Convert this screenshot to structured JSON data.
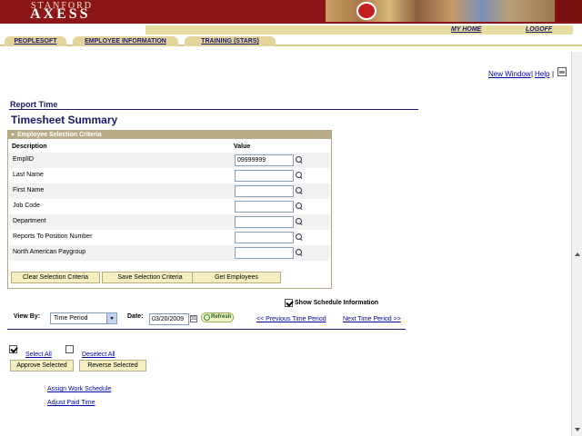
{
  "header": {
    "logo_top": "STANFORD",
    "logo_main": "AXESS",
    "my_home": "MY HOME",
    "logoff": "LOGOFF"
  },
  "tabs": [
    {
      "label": "PEOPLESOFT"
    },
    {
      "label": "EMPLOYEE INFORMATION"
    },
    {
      "label": "TRAINING (STARS)"
    }
  ],
  "toplinks": {
    "new_window": "New Window",
    "sep": "|",
    "help": "Help",
    "sep2": "|"
  },
  "page": {
    "report_time": "Report Time",
    "title": "Timesheet Summary"
  },
  "criteria": {
    "header": "Employee Selection Criteria",
    "col_description": "Description",
    "col_value": "Value",
    "rows": [
      {
        "label": "EmplID",
        "value": "09999999"
      },
      {
        "label": "Last Name",
        "value": ""
      },
      {
        "label": "First Name",
        "value": ""
      },
      {
        "label": "Job Code",
        "value": ""
      },
      {
        "label": "Department",
        "value": ""
      },
      {
        "label": "Reports To Position Number",
        "value": ""
      },
      {
        "label": "North American Paygroup",
        "value": ""
      }
    ],
    "buttons": {
      "clear": "Clear Selection Criteria",
      "save": "Save Selection Criteria",
      "get": "Get Employees"
    }
  },
  "schedule": {
    "show_label": "Show Schedule Information",
    "checked": true
  },
  "view": {
    "view_by_label": "View By:",
    "view_by_value": "Time Period",
    "date_label": "Date:",
    "date_value": "03/20/2009",
    "cal_glyph": "31",
    "refresh": "Refresh",
    "prev": "<< Previous Time Period",
    "next": "Next Time Period >>"
  },
  "actions": {
    "select_all": "Select All",
    "deselect_all": "Deselect All",
    "approve": "Approve Selected",
    "reverse": "Reverse Selected",
    "assign_schedule": "Assign Work Schedule",
    "adjust_paid": "Adjust Paid Time"
  },
  "colors": {
    "brand": "#8c1515",
    "tab": "#e2d49a",
    "link": "#0000aa",
    "title": "#1a1a6e"
  }
}
